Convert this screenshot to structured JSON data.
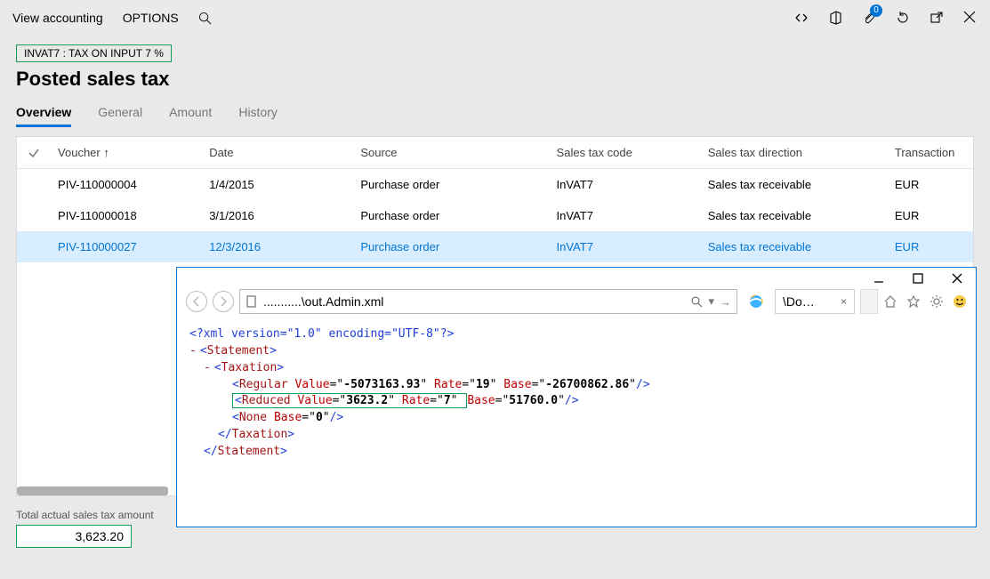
{
  "cmdbar": {
    "view_accounting": "View accounting",
    "options": "OPTIONS"
  },
  "notif_badge": "0",
  "chip": "INVAT7 : TAX ON INPUT 7 %",
  "title": "Posted sales tax",
  "tabs": {
    "overview": "Overview",
    "general": "General",
    "amount": "Amount",
    "history": "History"
  },
  "grid": {
    "cols": {
      "voucher": "Voucher",
      "date": "Date",
      "source": "Source",
      "code": "Sales tax code",
      "direction": "Sales tax direction",
      "currency": "Transaction"
    },
    "rows": [
      {
        "voucher": "PIV-110000004",
        "date": "1/4/2015",
        "source": "Purchase order",
        "code": "InVAT7",
        "direction": "Sales tax receivable",
        "currency": "EUR"
      },
      {
        "voucher": "PIV-110000018",
        "date": "3/1/2016",
        "source": "Purchase order",
        "code": "InVAT7",
        "direction": "Sales tax receivable",
        "currency": "EUR"
      },
      {
        "voucher": "PIV-110000027",
        "date": "12/3/2016",
        "source": "Purchase order",
        "code": "InVAT7",
        "direction": "Sales tax receivable",
        "currency": "EUR"
      }
    ]
  },
  "footer": {
    "label": "Total actual sales tax amount",
    "value": "3,623.20"
  },
  "ie": {
    "url": "...........\\out.Admin.xml",
    "tab": "\\Do…",
    "xml": {
      "decl": "<?xml version=\"1.0\" encoding=\"UTF-8\"?>",
      "regular": {
        "value": "-5073163.93",
        "rate": "19",
        "base": "-26700862.86"
      },
      "reduced": {
        "value": "3623.2",
        "rate": "7",
        "base": "51760.0"
      },
      "none": {
        "base": "0"
      }
    }
  }
}
